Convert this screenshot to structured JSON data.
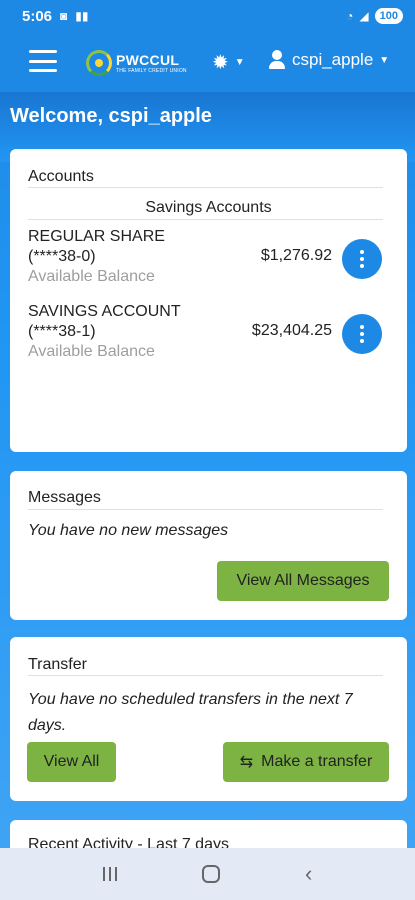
{
  "status_bar": {
    "time": "5:06",
    "battery": "100"
  },
  "app_bar": {
    "logo_name": "PWCCUL",
    "logo_tagline": "THE FAMILY CREDIT UNION",
    "username": "cspi_apple"
  },
  "welcome": "Welcome, cspi_apple",
  "accounts": {
    "title": "Accounts",
    "section_title": "Savings Accounts",
    "items": [
      {
        "name": "REGULAR SHARE",
        "number": "(****38-0)",
        "balance_label": "Available Balance",
        "balance": "$1,276.92"
      },
      {
        "name": "SAVINGS ACCOUNT",
        "number": "(****38-1)",
        "balance_label": "Available Balance",
        "balance": "$23,404.25"
      }
    ]
  },
  "messages": {
    "title": "Messages",
    "text": "You have no new messages",
    "button": "View All Messages"
  },
  "transfer": {
    "title": "Transfer",
    "text": "You have no scheduled transfers in the next 7 days.",
    "view_all": "View All",
    "make_transfer": "Make a transfer"
  },
  "recent_activity": {
    "title": "Recent Activity - Last 7 days"
  },
  "colors": {
    "primary": "#1E88E5",
    "accent_green": "#7CB342",
    "nav_bar": "#E3EAF6"
  },
  "icons": [
    "menu-icon",
    "gear-icon",
    "user-icon",
    "kebab-icon",
    "swap-icon",
    "recents-icon",
    "home-icon",
    "back-icon"
  ]
}
